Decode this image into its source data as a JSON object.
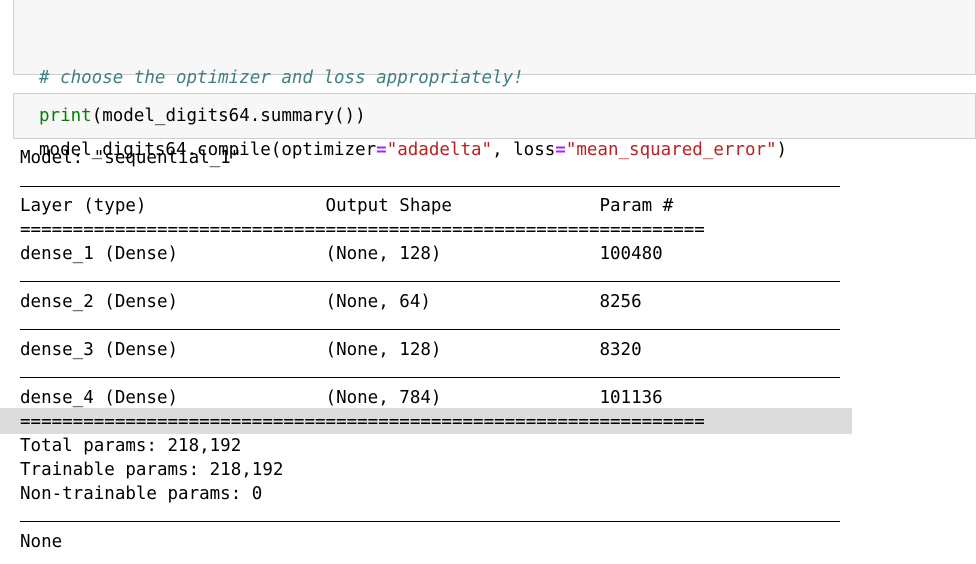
{
  "cell1": {
    "comment": "# choose the optimizer and loss appropriately!",
    "code_prefix": "model_digits64.compile(optimizer",
    "eq1": "=",
    "optimizer": "\"adadelta\"",
    "mid": ", loss",
    "eq2": "=",
    "loss": "\"mean_squared_error\"",
    "suffix": ")"
  },
  "cell2": {
    "print_kw": "print",
    "rest": "(model_digits64.summary())"
  },
  "output": {
    "model_line": "Model: \"sequential_1\"",
    "header": "Layer (type)                 Output Shape              Param #   ",
    "double_sep": "=================================================================",
    "rows": [
      "dense_1 (Dense)              (None, 128)               100480    ",
      "dense_2 (Dense)              (None, 64)                8256      ",
      "dense_3 (Dense)              (None, 128)               8320      ",
      "dense_4 (Dense)              (None, 784)               101136    "
    ],
    "total": "Total params: 218,192",
    "trainable": "Trainable params: 218,192",
    "non_trainable": "Non-trainable params: 0",
    "result": "None"
  }
}
